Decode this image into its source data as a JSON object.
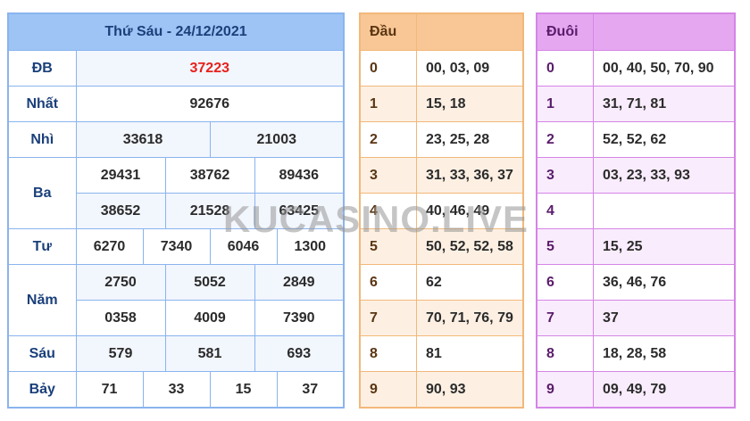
{
  "result": {
    "header": "Thứ Sáu - 24/12/2021",
    "rows": [
      {
        "label": "ĐB",
        "values": [
          "37223"
        ]
      },
      {
        "label": "Nhất",
        "values": [
          "92676"
        ]
      },
      {
        "label": "Nhì",
        "values": [
          "33618",
          "21003"
        ]
      },
      {
        "label": "Ba",
        "values": [
          "29431",
          "38762",
          "89436",
          "38652",
          "21528",
          "63425"
        ]
      },
      {
        "label": "Tư",
        "values": [
          "6270",
          "7340",
          "6046",
          "1300"
        ]
      },
      {
        "label": "Năm",
        "values": [
          "2750",
          "5052",
          "2849",
          "0358",
          "4009",
          "7390"
        ]
      },
      {
        "label": "Sáu",
        "values": [
          "579",
          "581",
          "693"
        ]
      },
      {
        "label": "Bảy",
        "values": [
          "71",
          "33",
          "15",
          "37"
        ]
      }
    ]
  },
  "dau": {
    "header": "Đầu",
    "rows": [
      {
        "k": "0",
        "v": "00, 03, 09"
      },
      {
        "k": "1",
        "v": "15, 18"
      },
      {
        "k": "2",
        "v": "23, 25, 28"
      },
      {
        "k": "3",
        "v": "31, 33, 36, 37"
      },
      {
        "k": "4",
        "v": "40, 46, 49"
      },
      {
        "k": "5",
        "v": "50, 52, 52, 58"
      },
      {
        "k": "6",
        "v": "62"
      },
      {
        "k": "7",
        "v": "70, 71, 76, 79"
      },
      {
        "k": "8",
        "v": "81"
      },
      {
        "k": "9",
        "v": "90, 93"
      }
    ]
  },
  "duoi": {
    "header": "Đuôi",
    "rows": [
      {
        "k": "0",
        "v": "00, 40, 50, 70, 90"
      },
      {
        "k": "1",
        "v": "31, 71, 81"
      },
      {
        "k": "2",
        "v": "52, 52, 62"
      },
      {
        "k": "3",
        "v": "03, 23, 33, 93"
      },
      {
        "k": "4",
        "v": ""
      },
      {
        "k": "5",
        "v": "15, 25"
      },
      {
        "k": "6",
        "v": "36, 46, 76"
      },
      {
        "k": "7",
        "v": "37"
      },
      {
        "k": "8",
        "v": "18, 28, 58"
      },
      {
        "k": "9",
        "v": "09, 49, 79"
      }
    ]
  },
  "watermark": "KUCASINO.LIVE"
}
